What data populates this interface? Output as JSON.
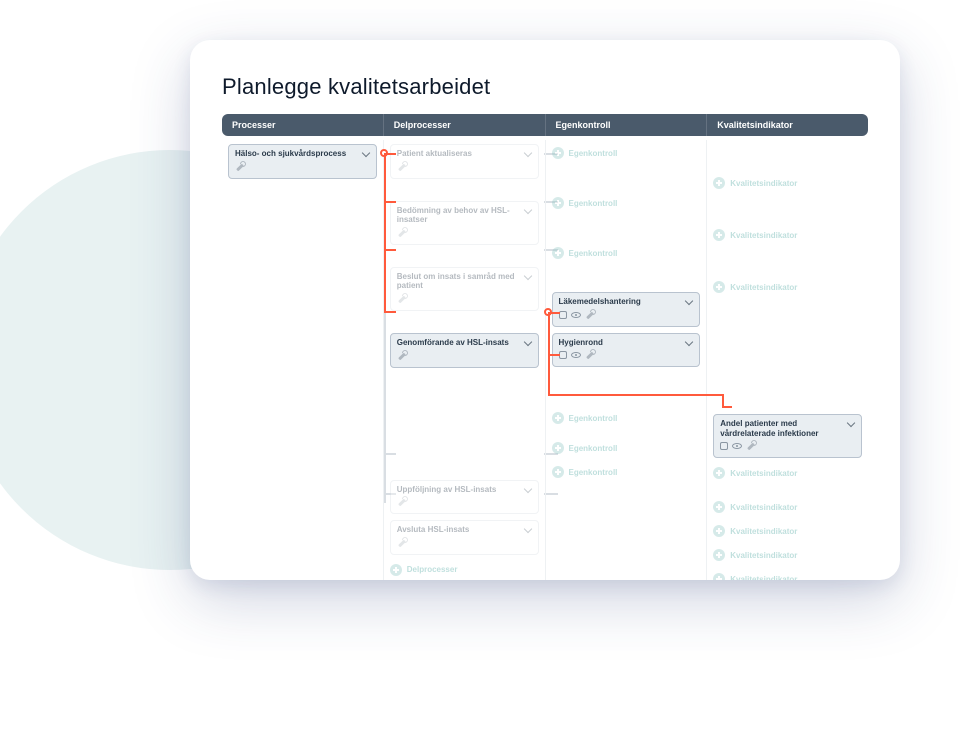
{
  "title": "Planlegge kvalitetsarbeidet",
  "columns": [
    "Processer",
    "Delprocesser",
    "Egenkontroll",
    "Kvalitetsindikator"
  ],
  "col1": {
    "process": "Hälso- och sjukvårdsprocess"
  },
  "col2": {
    "r0": "Patient aktualiseras",
    "r1": "Bedömning av behov av HSL-insatser",
    "r2": "Beslut om insats i samråd med patient",
    "r3": "Genomförande av HSL-insats",
    "r4": "Uppföljning av HSL-insats",
    "r5": "Avsluta HSL-insats",
    "add": "Delprocesser"
  },
  "col3": {
    "c0": "Läkemedelshantering",
    "c1": "Hygienrond",
    "ghost": "Egenkontroll"
  },
  "col4": {
    "k0": "Andel patienter med vårdrelaterade infektioner",
    "ghost": "Kvalitetsindikator"
  }
}
